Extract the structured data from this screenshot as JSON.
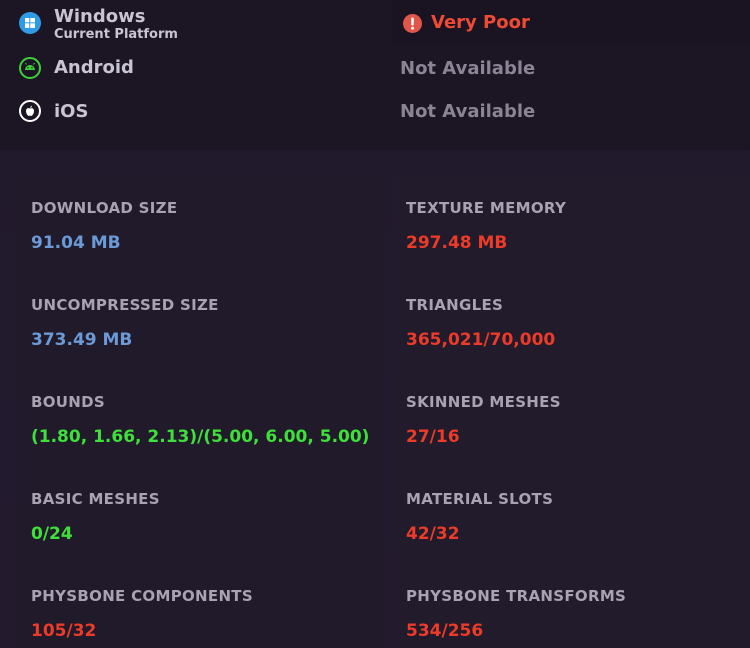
{
  "platforms": [
    {
      "name": "Windows",
      "subtitle": "Current Platform",
      "icon": "windows-icon",
      "color": "#2f9be6"
    },
    {
      "name": "Android",
      "status": "Not Available",
      "icon": "android-icon",
      "color": "#3ecf3a"
    },
    {
      "name": "iOS",
      "status": "Not Available",
      "icon": "apple-icon",
      "color": "#ffffff"
    }
  ],
  "rating": {
    "text": "Very Poor",
    "icon": "exclamation-circle-icon",
    "color": "#ef4a36"
  },
  "stats": [
    {
      "label": "DOWNLOAD SIZE",
      "value": "91.04 MB",
      "color": "blue"
    },
    {
      "label": "TEXTURE MEMORY",
      "value": "297.48 MB",
      "color": "red"
    },
    {
      "label": "UNCOMPRESSED SIZE",
      "value": "373.49 MB",
      "color": "blue"
    },
    {
      "label": "TRIANGLES",
      "value": "365,021/70,000",
      "color": "red"
    },
    {
      "label": "BOUNDS",
      "value": "(1.80, 1.66, 2.13)/(5.00, 6.00, 5.00)",
      "color": "green"
    },
    {
      "label": "SKINNED MESHES",
      "value": "27/16",
      "color": "red"
    },
    {
      "label": "BASIC MESHES",
      "value": "0/24",
      "color": "green"
    },
    {
      "label": "MATERIAL SLOTS",
      "value": "42/32",
      "color": "red"
    },
    {
      "label": "PHYSBONE COMPONENTS",
      "value": "105/32",
      "color": "red"
    },
    {
      "label": "PHYSBONE TRANSFORMS",
      "value": "534/256",
      "color": "red"
    }
  ]
}
